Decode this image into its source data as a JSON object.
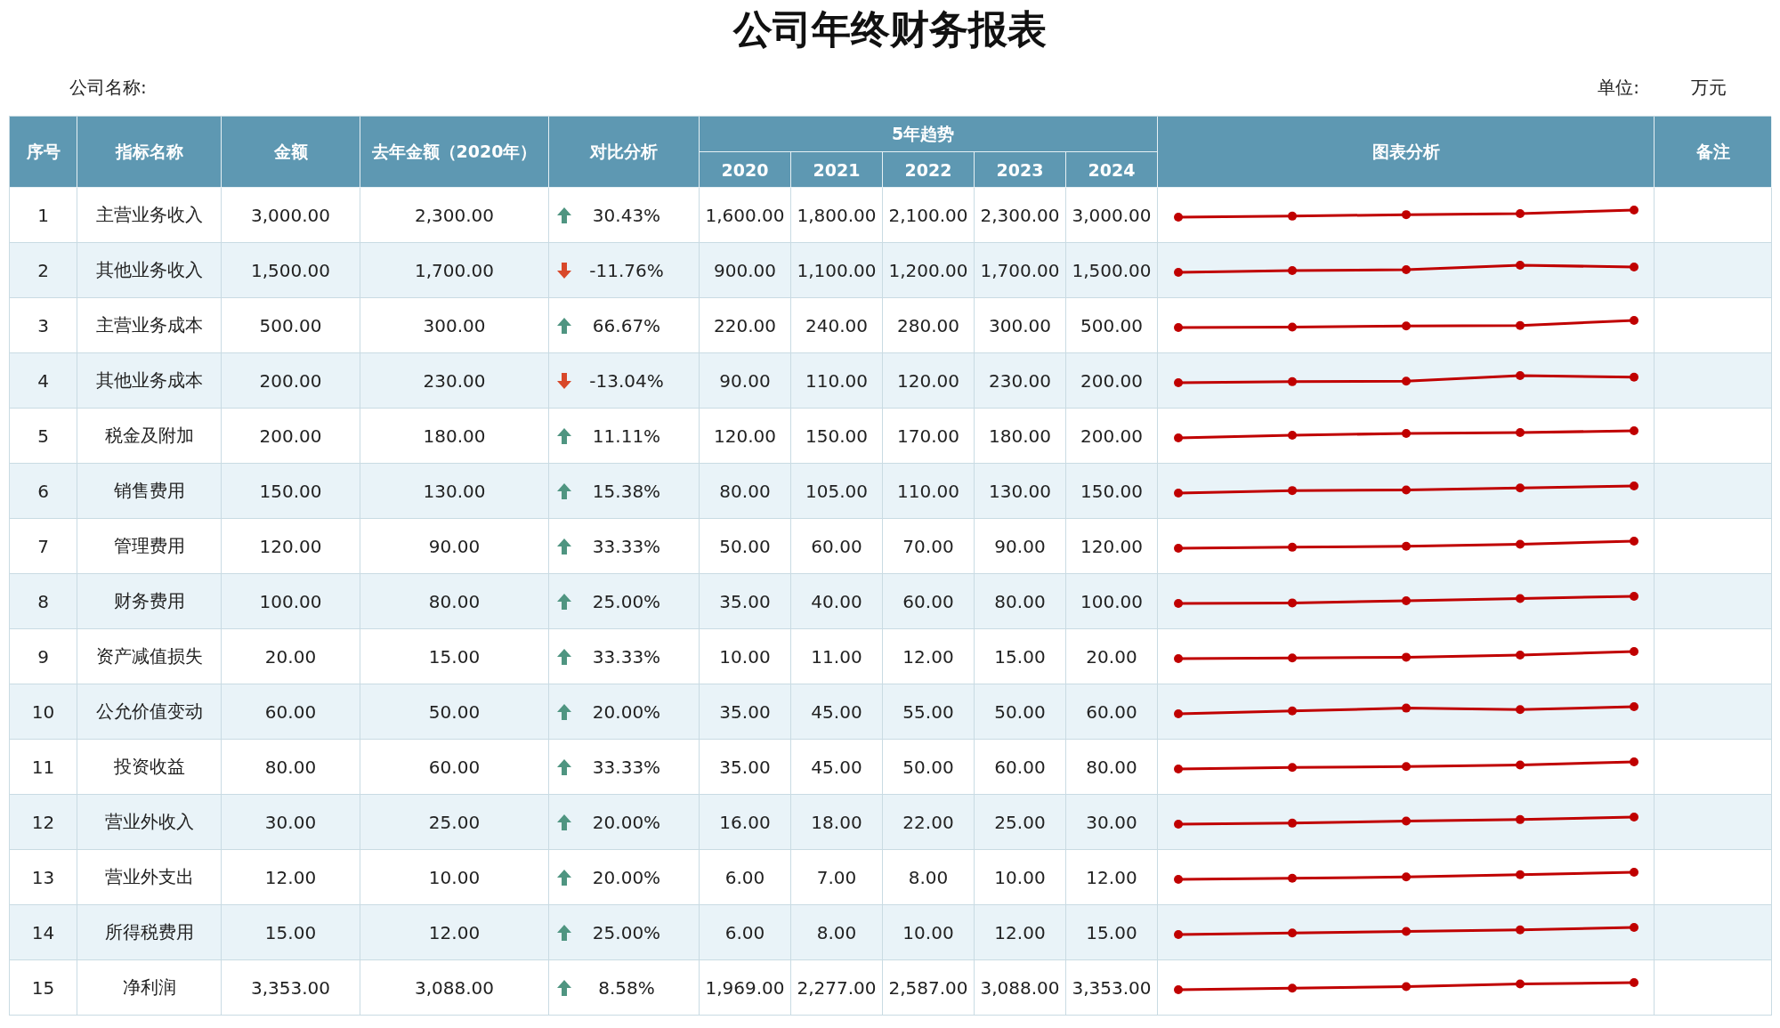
{
  "title": "公司年终财务报表",
  "company_label": "公司名称:",
  "unit_label": "单位:",
  "unit_value": "万元",
  "headers": {
    "seq": "序号",
    "name": "指标名称",
    "amount": "金额",
    "last_year": "去年金额（2020年）",
    "compare": "对比分析",
    "trend_group": "5年趋势",
    "years": [
      "2020",
      "2021",
      "2022",
      "2023",
      "2024"
    ],
    "chart": "图表分析",
    "note": "备注"
  },
  "rows": [
    {
      "no": "1",
      "name": "主营业务收入",
      "amount": "3,000.00",
      "last_year": "2,300.00",
      "kind": "up",
      "change": "30.43%",
      "trend": [
        "1,600.00",
        "1,800.00",
        "2,100.00",
        "2,300.00",
        "3,000.00"
      ]
    },
    {
      "no": "2",
      "name": "其他业务收入",
      "amount": "1,500.00",
      "last_year": "1,700.00",
      "kind": "down",
      "change": "-11.76%",
      "trend": [
        "900.00",
        "1,100.00",
        "1,200.00",
        "1,700.00",
        "1,500.00"
      ]
    },
    {
      "no": "3",
      "name": "主营业务成本",
      "amount": "500.00",
      "last_year": "300.00",
      "kind": "up",
      "change": "66.67%",
      "trend": [
        "220.00",
        "240.00",
        "280.00",
        "300.00",
        "500.00"
      ]
    },
    {
      "no": "4",
      "name": "其他业务成本",
      "amount": "200.00",
      "last_year": "230.00",
      "kind": "down",
      "change": "-13.04%",
      "trend": [
        "90.00",
        "110.00",
        "120.00",
        "230.00",
        "200.00"
      ]
    },
    {
      "no": "5",
      "name": "税金及附加",
      "amount": "200.00",
      "last_year": "180.00",
      "kind": "up",
      "change": "11.11%",
      "trend": [
        "120.00",
        "150.00",
        "170.00",
        "180.00",
        "200.00"
      ]
    },
    {
      "no": "6",
      "name": "销售费用",
      "amount": "150.00",
      "last_year": "130.00",
      "kind": "up",
      "change": "15.38%",
      "trend": [
        "80.00",
        "105.00",
        "110.00",
        "130.00",
        "150.00"
      ]
    },
    {
      "no": "7",
      "name": "管理费用",
      "amount": "120.00",
      "last_year": "90.00",
      "kind": "up",
      "change": "33.33%",
      "trend": [
        "50.00",
        "60.00",
        "70.00",
        "90.00",
        "120.00"
      ]
    },
    {
      "no": "8",
      "name": "财务费用",
      "amount": "100.00",
      "last_year": "80.00",
      "kind": "up",
      "change": "25.00%",
      "trend": [
        "35.00",
        "40.00",
        "60.00",
        "80.00",
        "100.00"
      ]
    },
    {
      "no": "9",
      "name": "资产减值损失",
      "amount": "20.00",
      "last_year": "15.00",
      "kind": "up",
      "change": "33.33%",
      "trend": [
        "10.00",
        "11.00",
        "12.00",
        "15.00",
        "20.00"
      ]
    },
    {
      "no": "10",
      "name": "公允价值变动",
      "amount": "60.00",
      "last_year": "50.00",
      "kind": "up",
      "change": "20.00%",
      "trend": [
        "35.00",
        "45.00",
        "55.00",
        "50.00",
        "60.00"
      ]
    },
    {
      "no": "11",
      "name": "投资收益",
      "amount": "80.00",
      "last_year": "60.00",
      "kind": "up",
      "change": "33.33%",
      "trend": [
        "35.00",
        "45.00",
        "50.00",
        "60.00",
        "80.00"
      ]
    },
    {
      "no": "12",
      "name": "营业外收入",
      "amount": "30.00",
      "last_year": "25.00",
      "kind": "up",
      "change": "20.00%",
      "trend": [
        "16.00",
        "18.00",
        "22.00",
        "25.00",
        "30.00"
      ]
    },
    {
      "no": "13",
      "name": "营业外支出",
      "amount": "12.00",
      "last_year": "10.00",
      "kind": "up",
      "change": "20.00%",
      "trend": [
        "6.00",
        "7.00",
        "8.00",
        "10.00",
        "12.00"
      ]
    },
    {
      "no": "14",
      "name": "所得税费用",
      "amount": "15.00",
      "last_year": "12.00",
      "kind": "up",
      "change": "25.00%",
      "trend": [
        "6.00",
        "8.00",
        "10.00",
        "12.00",
        "15.00"
      ]
    },
    {
      "no": "15",
      "name": "净利润",
      "amount": "3,353.00",
      "last_year": "3,088.00",
      "kind": "up",
      "change": "8.58%",
      "trend": [
        "1,969.00",
        "2,277.00",
        "2,587.00",
        "3,088.00",
        "3,353.00"
      ]
    }
  ]
}
